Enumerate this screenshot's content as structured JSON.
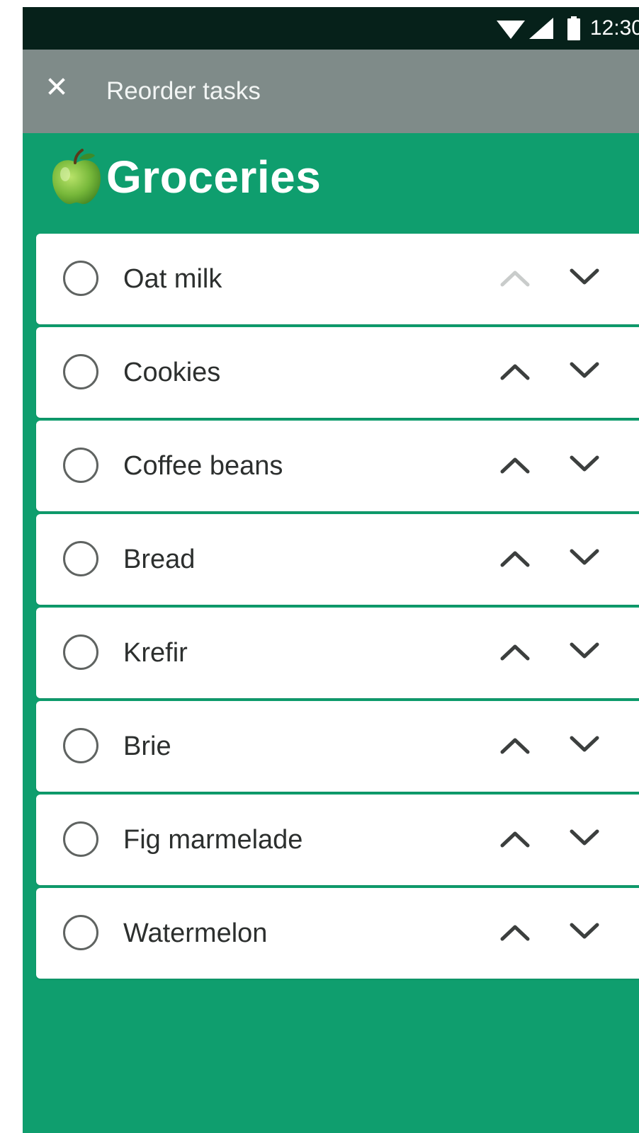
{
  "status_bar": {
    "time": "12:30",
    "icons": [
      "wifi-icon",
      "cell-signal-icon",
      "battery-icon"
    ]
  },
  "app_bar": {
    "close_icon": "close-icon",
    "title": "Reorder tasks"
  },
  "list": {
    "emoji": "green-apple-icon",
    "title": "Groceries"
  },
  "tasks": [
    {
      "label": "Oat milk",
      "up_enabled": false,
      "down_enabled": true
    },
    {
      "label": "Cookies",
      "up_enabled": true,
      "down_enabled": true
    },
    {
      "label": "Coffee beans",
      "up_enabled": true,
      "down_enabled": true
    },
    {
      "label": "Bread",
      "up_enabled": true,
      "down_enabled": true
    },
    {
      "label": "Krefir",
      "up_enabled": true,
      "down_enabled": true
    },
    {
      "label": "Brie",
      "up_enabled": true,
      "down_enabled": true
    },
    {
      "label": "Fig marmelade",
      "up_enabled": true,
      "down_enabled": true
    },
    {
      "label": "Watermelon",
      "up_enabled": true,
      "down_enabled": true
    }
  ],
  "colors": {
    "background": "#0f9e6e",
    "app_bar": "#7f8b89",
    "status_bar": "#06211a",
    "icon_active": "#3c3f3e",
    "icon_disabled": "#c9cccb"
  }
}
